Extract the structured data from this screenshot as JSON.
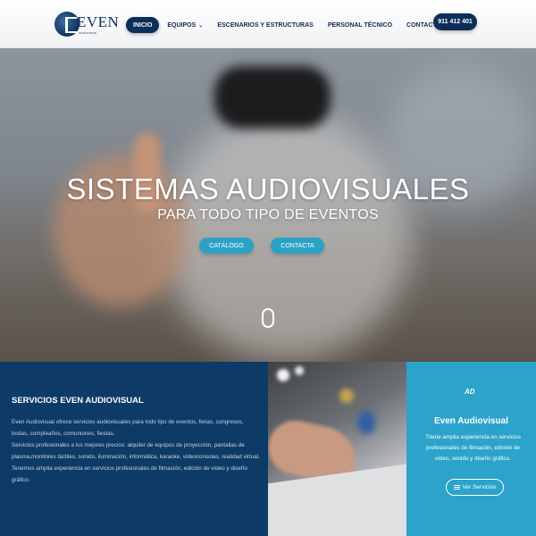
{
  "header": {
    "logo_text": "EVEN",
    "logo_sub": "audiovisual",
    "nav": [
      {
        "label": "INICIO"
      },
      {
        "label": "EQUIPOS"
      },
      {
        "label": "ESCENARIOS Y ESTRUCTURAS"
      },
      {
        "label": "PERSONAL TÉCNICO"
      },
      {
        "label": "CONTACTA"
      }
    ],
    "phone": "911 412 401"
  },
  "hero": {
    "title": "SISTEMAS AUDIOVISUALES",
    "subtitle": "PARA TODO TIPO DE EVENTOS",
    "btn_catalog": "CATÁLOGO",
    "btn_contact": "CONTACTA"
  },
  "services": {
    "title": "SERVICIOS EVEN AUDIOVISUAL",
    "paragraphs": [
      "Even Audiovisual ofrece servicios audiovisuales para todo tipo de eventos, ferias, congresos, bodas, cumpleaños, comuniones, fiestas.",
      "Servicios profesionales a los mejores precios: alquiler de equipos de proyección, pantallas de plasma,monitores táctiles, sonido, iluminación, informática, karaoke, videoconsolas, realidad virtual.",
      "Tenemos amplia experiencia en servicios profesionales de filmación, edición de vídeo y diseño gráfico."
    ]
  },
  "side": {
    "logo": "AD",
    "title": "Even Audiovisual",
    "text": "Ttiene amplia experiencia en servicios profesionales de filmación, edición de vídeo, sonido y diseño gráfico.",
    "button": "Ver Servicios"
  },
  "colors": {
    "navy": "#0d2e58",
    "accent": "#2aa2c6",
    "panel_blue": "#0e3a67"
  }
}
